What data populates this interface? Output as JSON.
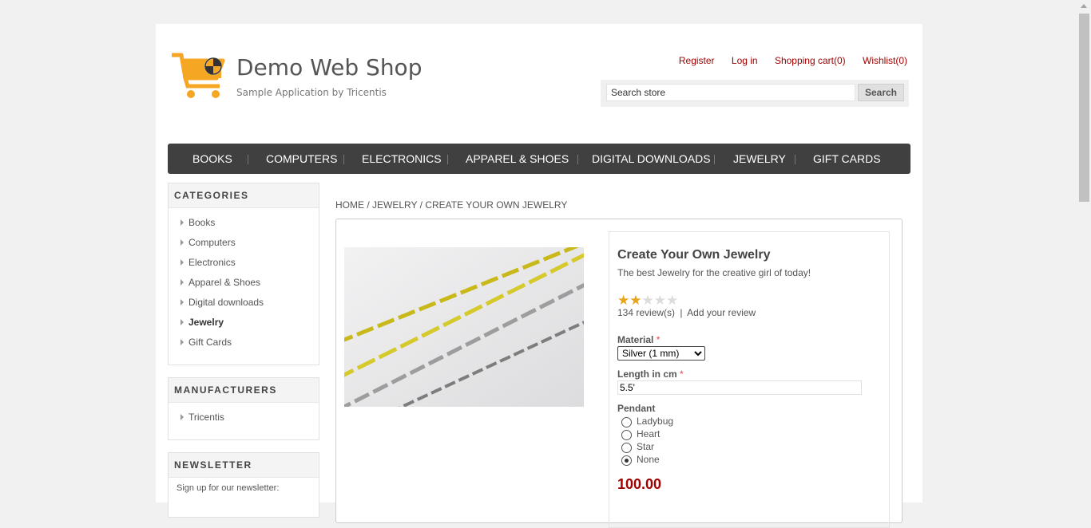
{
  "header": {
    "title": "Demo Web Shop",
    "subtitle": "Sample Application by Tricentis",
    "links": {
      "register": "Register",
      "login": "Log in",
      "cart": "Shopping cart(0)",
      "wishlist": "Wishlist(0)"
    },
    "search": {
      "value": "Search store",
      "button": "Search"
    }
  },
  "top_menu": [
    "BOOKS",
    "COMPUTERS",
    "ELECTRONICS",
    "APPAREL & SHOES",
    "DIGITAL DOWNLOADS",
    "JEWELRY",
    "GIFT CARDS"
  ],
  "categories": {
    "title": "CATEGORIES",
    "items": [
      "Books",
      "Computers",
      "Electronics",
      "Apparel & Shoes",
      "Digital downloads",
      "Jewelry",
      "Gift Cards"
    ],
    "active": "Jewelry"
  },
  "manufacturers": {
    "title": "MANUFACTURERS",
    "items": [
      "Tricentis"
    ]
  },
  "newsletter": {
    "title": "NEWSLETTER",
    "text": "Sign up for our newsletter:"
  },
  "breadcrumb": {
    "home": "HOME",
    "sep": "/",
    "category": "JEWELRY",
    "current": "CREATE YOUR OWN JEWELRY"
  },
  "product": {
    "name": "Create Your Own Jewelry",
    "short_description": "The best Jewelry for the creative girl of today!",
    "rating_stars": 2,
    "rating_max": 5,
    "reviews": "134 review(s)",
    "review_sep": "|",
    "add_review": "Add your review",
    "material_label": "Material",
    "required_mark": "*",
    "material_value": "Silver (1 mm)",
    "length_label": "Length in cm",
    "length_value": "5.5'",
    "pendant_label": "Pendant",
    "pendant_options": [
      "Ladybug",
      "Heart",
      "Star",
      "None"
    ],
    "pendant_selected": "None",
    "price": "100.00"
  },
  "colors": {
    "link_red": "#a30000",
    "menu_bg": "#404040",
    "logo_orange": "#f5a623",
    "star_gold": "#e8a41b"
  },
  "icons": {
    "logo": "shopping-cart-icon",
    "list_bullet": "triangle-right-icon"
  }
}
